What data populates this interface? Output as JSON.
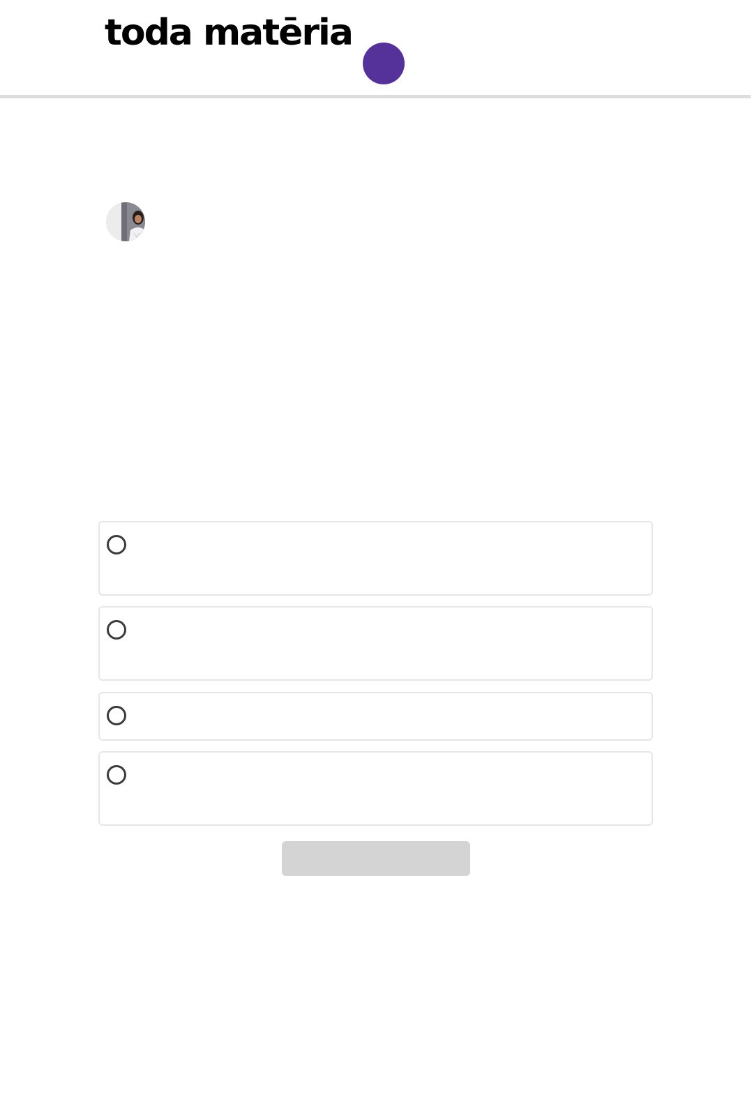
{
  "header": {
    "logo_text": "toda matēria",
    "accent_color": "#54329a"
  },
  "quiz": {
    "options": [
      {
        "label": ""
      },
      {
        "label": ""
      },
      {
        "label": ""
      },
      {
        "label": ""
      }
    ],
    "submit_label": "",
    "submit_color": "#d4d4d4"
  }
}
